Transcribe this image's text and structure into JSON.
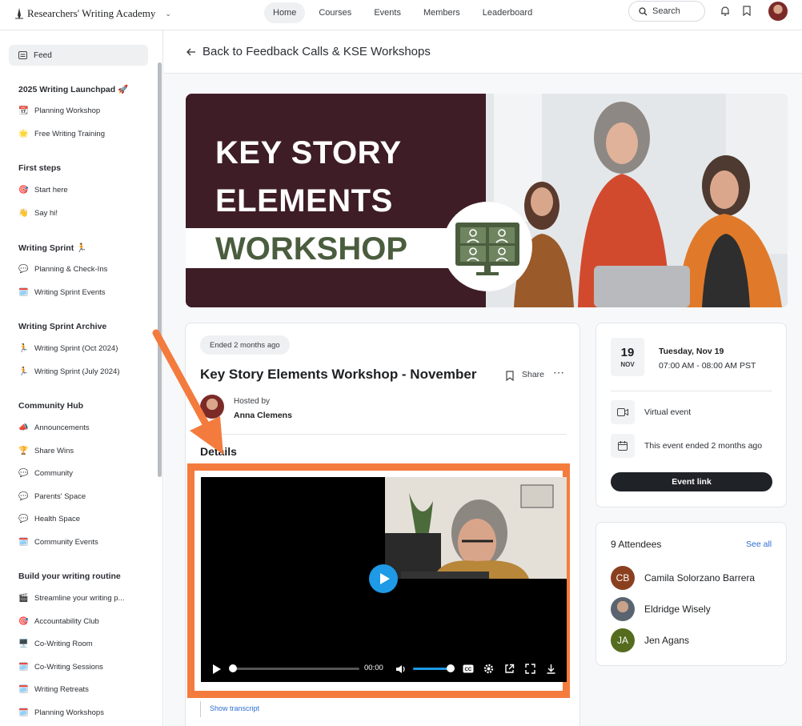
{
  "header": {
    "brand": "Researchers' Writing Academy",
    "nav": [
      "Home",
      "Courses",
      "Events",
      "Members",
      "Leaderboard"
    ],
    "active_nav": "Home",
    "search_label": "Search"
  },
  "sidebar": {
    "feed": "Feed",
    "sections": [
      {
        "title": "2025 Writing Launchpad 🚀",
        "items": [
          {
            "emoji": "📆",
            "label": "Planning Workshop"
          },
          {
            "emoji": "🌟",
            "label": "Free Writing Training"
          }
        ]
      },
      {
        "title": "First steps",
        "items": [
          {
            "emoji": "🎯",
            "label": "Start here"
          },
          {
            "emoji": "👋",
            "label": "Say hi!"
          }
        ]
      },
      {
        "title": "Writing Sprint 🏃",
        "items": [
          {
            "emoji": "💬",
            "label": "Planning & Check-Ins"
          },
          {
            "emoji": "🗓️",
            "label": "Writing Sprint Events"
          }
        ]
      },
      {
        "title": "Writing Sprint Archive",
        "items": [
          {
            "emoji": "🏃",
            "label": "Writing Sprint (Oct 2024)"
          },
          {
            "emoji": "🏃",
            "label": "Writing Sprint (July 2024)"
          }
        ]
      },
      {
        "title": "Community Hub",
        "items": [
          {
            "emoji": "📣",
            "label": "Announcements"
          },
          {
            "emoji": "🏆",
            "label": "Share Wins"
          },
          {
            "emoji": "💬",
            "label": "Community"
          },
          {
            "emoji": "💬",
            "label": "Parents' Space"
          },
          {
            "emoji": "💬",
            "label": "Health Space"
          },
          {
            "emoji": "🗓️",
            "label": "Community Events"
          }
        ]
      },
      {
        "title": "Build your writing routine",
        "items": [
          {
            "emoji": "🎬",
            "label": "Streamline your writing p..."
          },
          {
            "emoji": "🎯",
            "label": "Accountability Club"
          },
          {
            "emoji": "🖥️",
            "label": "Co-Writing Room"
          },
          {
            "emoji": "🗓️",
            "label": "Co-Writing Sessions"
          },
          {
            "emoji": "🗓️",
            "label": "Writing Retreats"
          },
          {
            "emoji": "🗓️",
            "label": "Planning Workshops"
          }
        ]
      }
    ]
  },
  "back_link": "Back to Feedback Calls & KSE Workshops",
  "banner": {
    "line1": "KEY STORY",
    "line2": "ELEMENTS",
    "line3": "WORKSHOP"
  },
  "event": {
    "status": "Ended 2 months ago",
    "title": "Key Story Elements Workshop - November",
    "share_label": "Share",
    "hosted_by_label": "Hosted by",
    "host": "Anna Clemens",
    "details_label": "Details",
    "video_time": "00:00",
    "show_transcript": "Show transcript"
  },
  "date_card": {
    "day": "19",
    "month": "NOV",
    "date_line": "Tuesday, Nov 19",
    "time_line": "07:00 AM - 08:00 AM PST",
    "location": "Virtual event",
    "ended": "This event ended 2 months ago",
    "link_label": "Event link"
  },
  "attendees": {
    "title": "9 Attendees",
    "see_all": "See all",
    "list": [
      {
        "initials": "CB",
        "name": "Camila Solorzano Barrera",
        "color": "#8a3f1e"
      },
      {
        "initials": "",
        "name": "Eldridge Wisely",
        "color": "#5a6470"
      },
      {
        "initials": "JA",
        "name": "Jen Agans",
        "color": "#556b1e"
      }
    ]
  },
  "colors": {
    "highlight": "#f47b3e",
    "banner": "#3e1d27",
    "play": "#1e9ae6",
    "link": "#2c6fd1"
  }
}
